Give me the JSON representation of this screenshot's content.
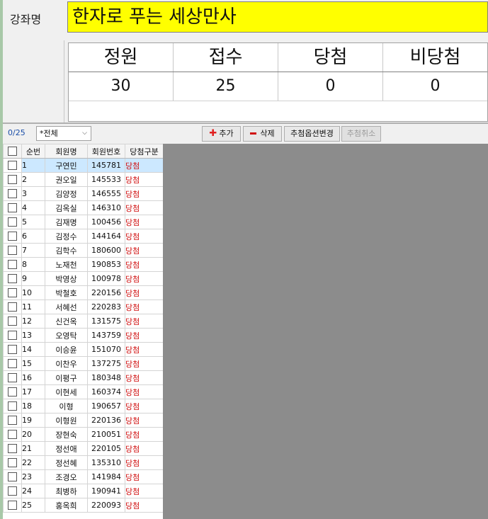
{
  "course": {
    "label": "강좌명",
    "title": "한자로 푸는 세상만사"
  },
  "stats": {
    "headers": [
      "정원",
      "접수",
      "당첨",
      "비당첨"
    ],
    "values": [
      "30",
      "25",
      "0",
      "0"
    ]
  },
  "toolbar": {
    "count": "0/25",
    "filter_value": "*전체",
    "add_label": "추가",
    "delete_label": "삭제",
    "option_label": "추첨옵션변경",
    "cancel_label": "추첨취소"
  },
  "grid": {
    "columns": [
      "순번",
      "회원명",
      "회원번호",
      "당첨구분"
    ],
    "rows": [
      {
        "no": "1",
        "name": "구연민",
        "id": "145781",
        "result": "당첨"
      },
      {
        "no": "2",
        "name": "권오일",
        "id": "145533",
        "result": "당첨"
      },
      {
        "no": "3",
        "name": "김양정",
        "id": "146555",
        "result": "당첨"
      },
      {
        "no": "4",
        "name": "김옥실",
        "id": "146310",
        "result": "당첨"
      },
      {
        "no": "5",
        "name": "김재명",
        "id": "100456",
        "result": "당첨"
      },
      {
        "no": "6",
        "name": "김정수",
        "id": "144164",
        "result": "당첨"
      },
      {
        "no": "7",
        "name": "김학수",
        "id": "180600",
        "result": "당첨"
      },
      {
        "no": "8",
        "name": "노재천",
        "id": "190853",
        "result": "당첨"
      },
      {
        "no": "9",
        "name": "박영상",
        "id": "100978",
        "result": "당첨"
      },
      {
        "no": "10",
        "name": "박철호",
        "id": "220156",
        "result": "당첨"
      },
      {
        "no": "11",
        "name": "서혜선",
        "id": "220283",
        "result": "당첨"
      },
      {
        "no": "12",
        "name": "신건옥",
        "id": "131575",
        "result": "당첨"
      },
      {
        "no": "13",
        "name": "오영탁",
        "id": "143759",
        "result": "당첨"
      },
      {
        "no": "14",
        "name": "이승윤",
        "id": "151070",
        "result": "당첨"
      },
      {
        "no": "15",
        "name": "이찬우",
        "id": "137275",
        "result": "당첨"
      },
      {
        "no": "16",
        "name": "이평구",
        "id": "180348",
        "result": "당첨"
      },
      {
        "no": "17",
        "name": "이현세",
        "id": "160374",
        "result": "당첨"
      },
      {
        "no": "18",
        "name": "이형",
        "id": "190657",
        "result": "당첨"
      },
      {
        "no": "19",
        "name": "이형원",
        "id": "220136",
        "result": "당첨"
      },
      {
        "no": "20",
        "name": "장현숙",
        "id": "210051",
        "result": "당첨"
      },
      {
        "no": "21",
        "name": "정선애",
        "id": "220105",
        "result": "당첨"
      },
      {
        "no": "22",
        "name": "정선혜",
        "id": "135310",
        "result": "당첨"
      },
      {
        "no": "23",
        "name": "조경오",
        "id": "141984",
        "result": "당첨"
      },
      {
        "no": "24",
        "name": "최병하",
        "id": "190941",
        "result": "당첨"
      },
      {
        "no": "25",
        "name": "홍옥희",
        "id": "220093",
        "result": "당첨"
      }
    ]
  }
}
